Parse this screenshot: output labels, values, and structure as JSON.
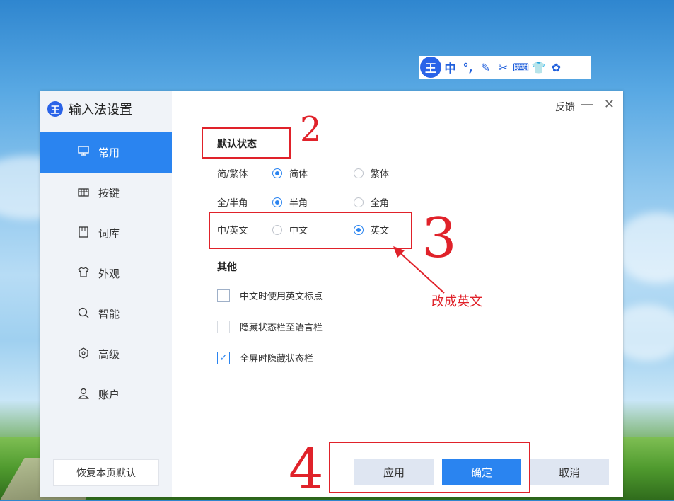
{
  "ime_toolbar": {
    "logo": "王",
    "items": [
      {
        "glyph": "中",
        "icon": "chinese-mode-icon"
      },
      {
        "glyph": "°,",
        "icon": "punctuation-icon"
      },
      {
        "glyph": "✎",
        "icon": "handwriting-icon"
      },
      {
        "glyph": "✂",
        "icon": "scissors-icon"
      },
      {
        "glyph": "⌨",
        "icon": "keyboard-icon"
      },
      {
        "glyph": "👕",
        "icon": "skin-icon"
      },
      {
        "glyph": "✿",
        "icon": "settings-icon"
      }
    ]
  },
  "window": {
    "logo": "王",
    "title": "输入法设置",
    "feedback": "反馈",
    "minimize": "—",
    "close": "✕"
  },
  "sidebar": {
    "items": [
      {
        "label": "常用",
        "icon": "monitor-icon",
        "glyph": "🖵"
      },
      {
        "label": "按键",
        "icon": "keyboard-icon",
        "glyph": "⌨"
      },
      {
        "label": "词库",
        "icon": "book-icon",
        "glyph": "⎕"
      },
      {
        "label": "外观",
        "icon": "shirt-icon",
        "glyph": "♈"
      },
      {
        "label": "智能",
        "icon": "search-icon",
        "glyph": "⚲"
      },
      {
        "label": "高级",
        "icon": "gear-icon",
        "glyph": "⊙"
      },
      {
        "label": "账户",
        "icon": "user-icon",
        "glyph": "♙"
      }
    ],
    "restore_default": "恢复本页默认"
  },
  "default_state": {
    "title": "默认状态",
    "rows": [
      {
        "label": "简/繁体",
        "options": [
          {
            "label": "简体",
            "selected": true
          },
          {
            "label": "繁体",
            "selected": false
          }
        ]
      },
      {
        "label": "全/半角",
        "options": [
          {
            "label": "半角",
            "selected": true
          },
          {
            "label": "全角",
            "selected": false
          }
        ]
      },
      {
        "label": "中/英文",
        "options": [
          {
            "label": "中文",
            "selected": false
          },
          {
            "label": "英文",
            "selected": true
          }
        ]
      }
    ]
  },
  "other": {
    "title": "其他",
    "checks": [
      {
        "label": "中文时使用英文标点",
        "checked": false,
        "disabled": false
      },
      {
        "label": "隐藏状态栏至语言栏",
        "checked": false,
        "disabled": true
      },
      {
        "label": "全屏时隐藏状态栏",
        "checked": true,
        "disabled": false
      }
    ]
  },
  "buttons": {
    "apply": "应用",
    "ok": "确定",
    "cancel": "取消"
  },
  "annotations": {
    "num2": "2",
    "num3": "3",
    "num4": "4",
    "note": "改成英文",
    "color": "#e0222a"
  },
  "colors": {
    "accent": "#2a84f0",
    "brand": "#2a63e8"
  }
}
